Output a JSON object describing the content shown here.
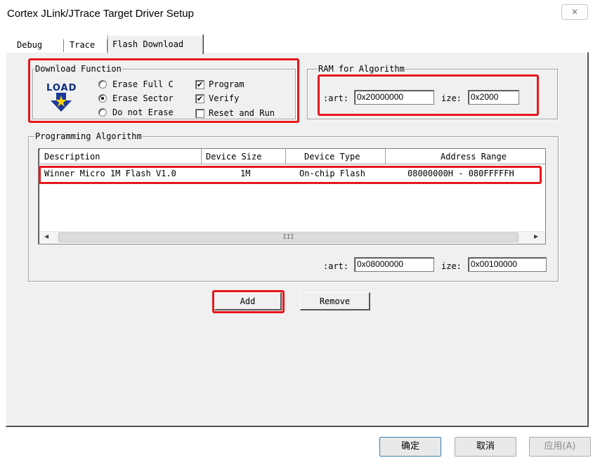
{
  "window": {
    "title": "Cortex JLink/JTrace Target Driver Setup",
    "close_glyph": "✕"
  },
  "tabs": [
    {
      "label": "Debug",
      "active": false
    },
    {
      "label": "Trace",
      "active": false
    },
    {
      "label": "Flash Download",
      "active": true
    }
  ],
  "download_function": {
    "group_label": "Download Function",
    "logo_text": "LOAD",
    "options": [
      {
        "label": "Erase Full C",
        "selected": false
      },
      {
        "label": "Erase Sector",
        "selected": true
      },
      {
        "label": "Do not Erase",
        "selected": false
      }
    ],
    "checkboxes": [
      {
        "label": "Program",
        "checked": true
      },
      {
        "label": "Verify",
        "checked": true
      },
      {
        "label": "Reset and Run",
        "checked": false
      }
    ],
    "check_glyph": "✔"
  },
  "ram_for_algorithm": {
    "group_label": "RAM for Algorithm",
    "start_label": ":art:",
    "start_value": "0x20000000",
    "size_label": "ize:",
    "size_value": "0x2000"
  },
  "programming_algorithm": {
    "group_label": "Programming Algorithm",
    "columns": [
      "Description",
      "Device Size",
      "Device Type",
      "Address Range"
    ],
    "rows": [
      {
        "description": "Winner Micro 1M Flash V1.0",
        "device_size": "1M",
        "device_type": "On-chip Flash",
        "address_range": "08000000H - 080FFFFFH"
      }
    ],
    "scroll_grip": "III",
    "scroll_left": "◀",
    "scroll_right": "▶",
    "start_label": ":art:",
    "start_value": "0x08000000",
    "size_label": "ize:",
    "size_value": "0x00100000"
  },
  "buttons": {
    "add": "Add",
    "remove": "Remove"
  },
  "footer": {
    "ok": "确定",
    "cancel": "取消",
    "apply": "应用(A)"
  },
  "colors": {
    "highlight": "#e8161c",
    "panel": "#f0f0f0"
  }
}
